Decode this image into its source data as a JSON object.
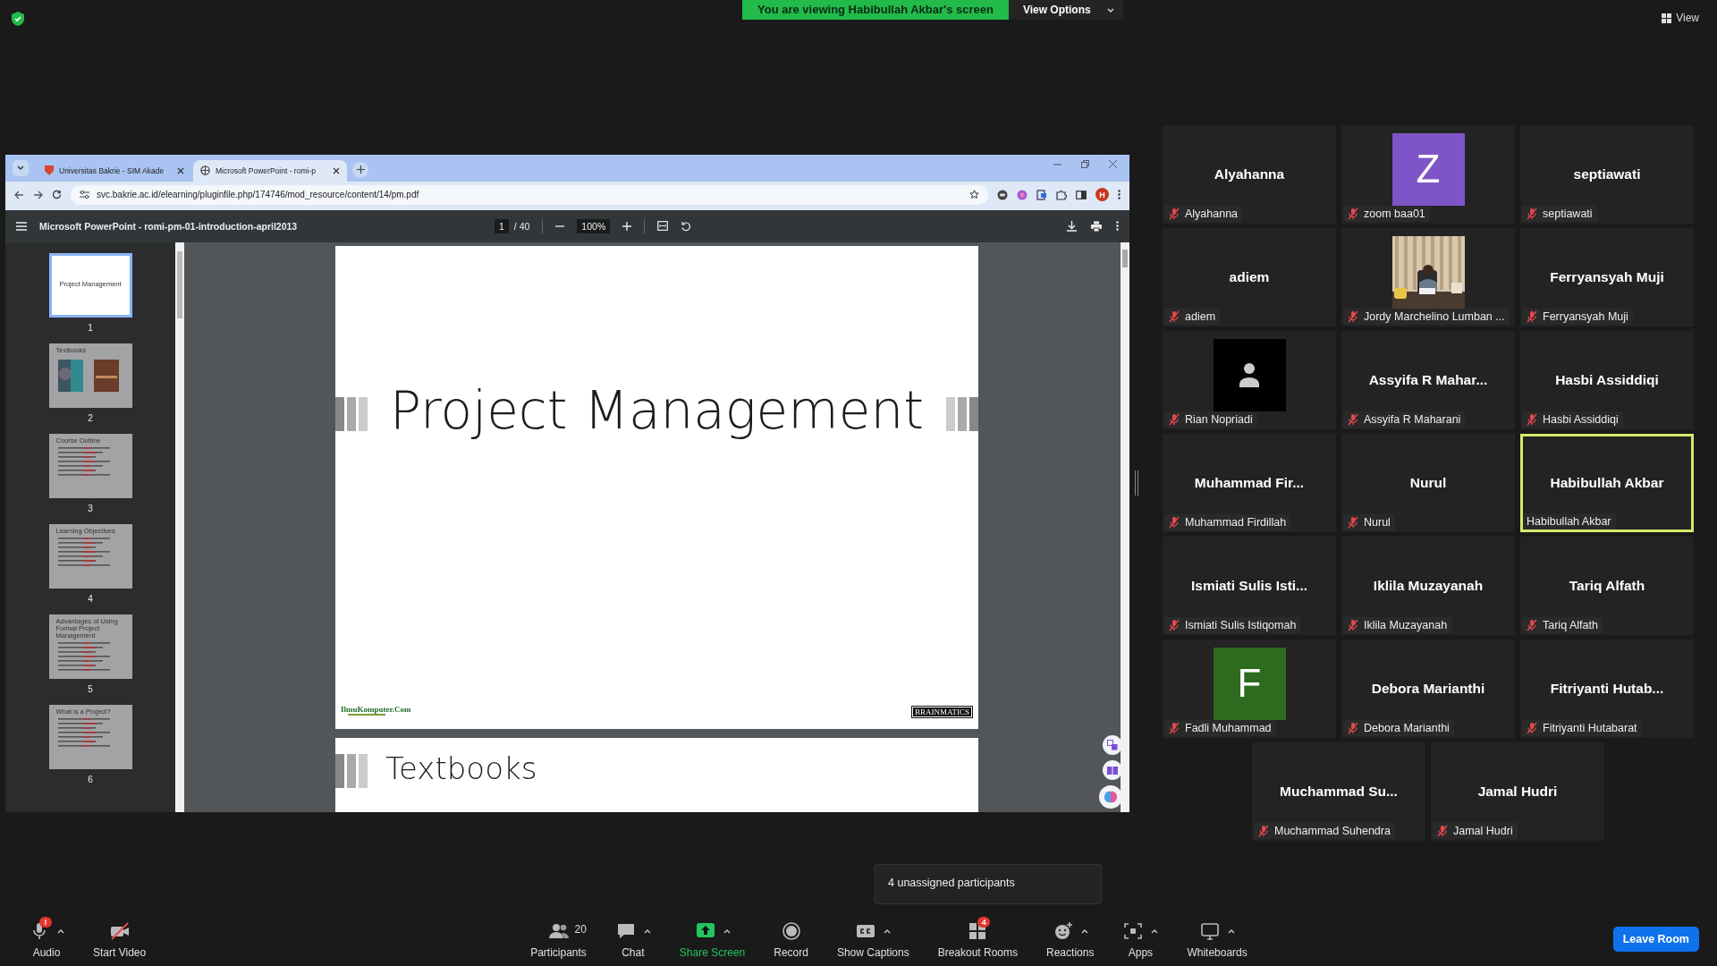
{
  "top_bar": {
    "banner": "You are viewing Habibullah Akbar's screen",
    "view_options": "View Options",
    "view_button": "View"
  },
  "browser": {
    "tabs": [
      {
        "title": "Universitas Bakrie - SIM Akade",
        "selected": false
      },
      {
        "title": "Microsoft PowerPoint - romi-p",
        "selected": true
      }
    ],
    "address": "svc.bakrie.ac.id/elearning/pluginfile.php/174746/mod_resource/content/14/pm.pdf",
    "profile_initial": "H",
    "pdf_toolbar": {
      "title": "Microsoft PowerPoint - romi-pm-01-introduction-april2013",
      "page": "1",
      "page_count": "/ 40",
      "zoom": "100%"
    },
    "thumbnails": [
      {
        "number": "1",
        "title": "Project Management",
        "kind": "title",
        "selected": true
      },
      {
        "number": "2",
        "title": "Textbooks",
        "kind": "books",
        "selected": false
      },
      {
        "number": "3",
        "title": "Course Outline",
        "kind": "bullets",
        "selected": false
      },
      {
        "number": "4",
        "title": "Learning Objectives",
        "kind": "bullets",
        "selected": false
      },
      {
        "number": "5",
        "title": "Advantages of Using Formal Project Management",
        "kind": "bullets",
        "selected": false
      },
      {
        "number": "6",
        "title": "What is a Project?",
        "kind": "bullets",
        "selected": false
      }
    ],
    "pages": [
      {
        "kind": "title",
        "title": "Project Management",
        "footer_left": "IlmuKomputer.Com",
        "footer_right": "BRAINMATICS"
      },
      {
        "kind": "heading",
        "title": "Textbooks"
      }
    ]
  },
  "participants": [
    {
      "name": "Alyahanna",
      "label": "Alyahanna",
      "muted": true,
      "highlighted": false,
      "avatar": {
        "kind": "name"
      }
    },
    {
      "label": "zoom baa01",
      "muted": true,
      "highlighted": false,
      "avatar": {
        "kind": "letter",
        "letter": "Z",
        "color": "#7e55c7"
      }
    },
    {
      "name": "septiawati",
      "label": "septiawati",
      "muted": true,
      "highlighted": false,
      "avatar": {
        "kind": "name"
      }
    },
    {
      "name": "adiem",
      "label": "adiem",
      "muted": true,
      "highlighted": false,
      "avatar": {
        "kind": "name"
      }
    },
    {
      "label": "Jordy Marchelino Lumban ...",
      "muted": true,
      "highlighted": false
    },
    {
      "name": "Ferryansyah Muji",
      "label": "Ferryansyah Muji",
      "muted": true,
      "highlighted": false,
      "avatar": {
        "kind": "name"
      }
    },
    {
      "label": "Rian Nopriadi",
      "muted": true,
      "highlighted": false,
      "avatar": {
        "kind": "silhouette"
      }
    },
    {
      "name": "Assyifa R Mahar...",
      "label": "Assyifa R Maharani",
      "muted": true,
      "highlighted": false,
      "avatar": {
        "kind": "name"
      }
    },
    {
      "name": "Hasbi Assiddiqi",
      "label": "Hasbi Assiddiqi",
      "muted": true,
      "highlighted": false,
      "avatar": {
        "kind": "name"
      }
    },
    {
      "name": "Muhammad Fir...",
      "label": "Muhammad Firdillah",
      "muted": true,
      "highlighted": false,
      "avatar": {
        "kind": "name"
      }
    },
    {
      "name": "Nurul",
      "label": "Nurul",
      "muted": true,
      "highlighted": false,
      "avatar": {
        "kind": "name"
      }
    },
    {
      "name": "Habibullah Akbar",
      "label": "Habibullah Akbar",
      "muted": false,
      "highlighted": true,
      "avatar": {
        "kind": "name"
      }
    },
    {
      "name": "Ismiati Sulis Isti...",
      "label": "Ismiati Sulis Istiqomah",
      "muted": true,
      "highlighted": false,
      "avatar": {
        "kind": "name"
      }
    },
    {
      "name": "Iklila Muzayanah",
      "label": "Iklila Muzayanah",
      "muted": true,
      "highlighted": false,
      "avatar": {
        "kind": "name"
      }
    },
    {
      "name": "Tariq Alfath",
      "label": "Tariq Alfath",
      "muted": true,
      "highlighted": false,
      "avatar": {
        "kind": "name"
      }
    },
    {
      "label": "Fadli Muhammad",
      "muted": true,
      "highlighted": false,
      "avatar": {
        "kind": "letter",
        "letter": "F",
        "color": "#2e6b1f"
      }
    },
    {
      "name": "Debora Marianthi",
      "label": "Debora Marianthi",
      "muted": true,
      "highlighted": false,
      "avatar": {
        "kind": "name"
      }
    },
    {
      "name": "Fitriyanti Hutab...",
      "label": "Fitriyanti Hutabarat",
      "muted": true,
      "highlighted": false,
      "avatar": {
        "kind": "name"
      }
    },
    {
      "name": "Muchammad Su...",
      "label": "Muchammad Suhendra",
      "muted": true,
      "highlighted": false,
      "avatar": {
        "kind": "name"
      }
    },
    {
      "name": "Jamal Hudri",
      "label": "Jamal Hudri",
      "muted": true,
      "highlighted": false,
      "avatar": {
        "kind": "name"
      }
    }
  ],
  "tooltip": "4 unassigned participants",
  "toolbar_left": [
    {
      "label": "Audio",
      "badge": "!",
      "caret": true
    },
    {
      "label": "Start Video",
      "caret": false
    }
  ],
  "toolbar_center": [
    {
      "label": "Participants",
      "count": "20",
      "caret": false
    },
    {
      "label": "Chat",
      "caret": true
    },
    {
      "label": "Share Screen",
      "caret": true
    },
    {
      "label": "Record",
      "caret": false
    },
    {
      "label": "Show Captions",
      "caret": true
    },
    {
      "label": "Breakout Rooms",
      "badge": "4",
      "caret": false
    },
    {
      "label": "Reactions",
      "caret": true
    },
    {
      "label": "Apps",
      "caret": true
    },
    {
      "label": "Whiteboards",
      "caret": true
    }
  ],
  "leave_button": "Leave Room"
}
